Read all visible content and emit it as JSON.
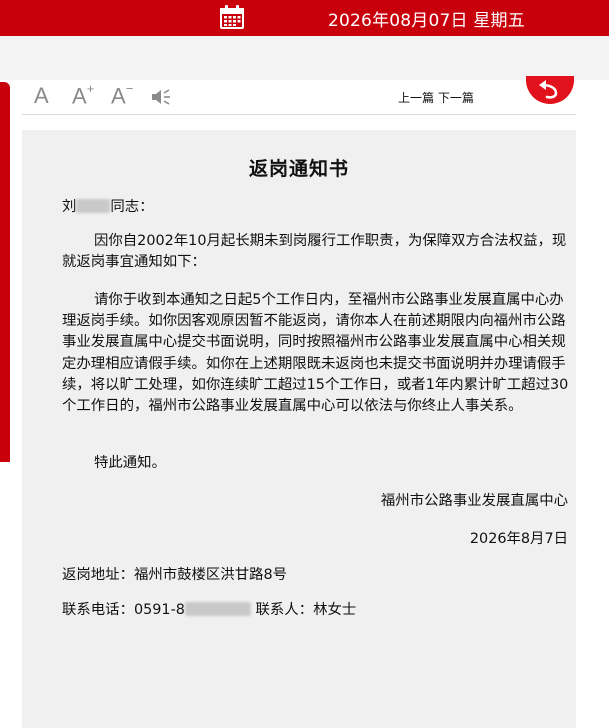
{
  "header": {
    "date_text": "2026年08月07日 星期五",
    "bg_color": "#c8000b",
    "icon": "calendar-icon"
  },
  "toolbar": {
    "font_default": "A",
    "font_increase": "A",
    "font_increase_sup": "+",
    "font_decrease": "A",
    "font_decrease_sup": "−",
    "speaker_icon": "speaker-icon",
    "prev_label": "上一篇",
    "next_label": "下一篇",
    "back_icon": "back-arrow-icon",
    "back_color": "#e1121b"
  },
  "document": {
    "title": "返岗通知书",
    "salutation_prefix": "刘",
    "salutation_suffix": "同志：",
    "paragraph1": "因你自2002年10月起长期未到岗履行工作职责，为保障双方合法权益，现就返岗事宜通知如下：",
    "paragraph2": "请你于收到本通知之日起5个工作日内，至福州市公路事业发展直属中心办理返岗手续。如你因客观原因暂不能返岗，请你本人在前述期限内向福州市公路事业发展直属中心提交书面说明，同时按照福州市公路事业发展直属中心相关规定办理相应请假手续。如你在上述期限既未返岗也未提交书面说明并办理请假手续，将以旷工处理，如你连续旷工超过15个工作日，或者1年内累计旷工超过30个工作日的，福州市公路事业发展直属中心可以依法与你终止人事关系。",
    "paragraph3": "特此通知。",
    "signature": "福州市公路事业发展直属中心",
    "sign_date": "2026年8月7日",
    "address": "返岗地址：福州市鼓楼区洪甘路8号",
    "phone_prefix": "联系电话：0591-8",
    "contact": "联系人：林女士"
  }
}
